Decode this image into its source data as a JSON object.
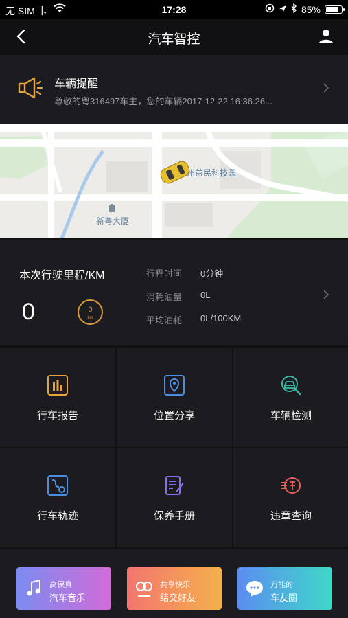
{
  "status_bar": {
    "carrier": "无 SIM 卡",
    "time": "17:28",
    "battery_percent": "85%",
    "battery_level": 0.85
  },
  "nav": {
    "title": "汽车智控"
  },
  "reminder": {
    "title": "车辆提醒",
    "message": "尊敬的粤316497车主，您的车辆2017-12-22 16:36:26..."
  },
  "map": {
    "poi_1": "州益民科技园",
    "poi_2": "新粤大厦"
  },
  "trip": {
    "title": "本次行驶里程/KM",
    "mileage": "0",
    "gauge_value": "0",
    "gauge_unit": "km",
    "stats": [
      {
        "label": "行程时间",
        "value": "0分钟"
      },
      {
        "label": "消耗油量",
        "value": "0L"
      },
      {
        "label": "平均油耗",
        "value": "0L/100KM"
      }
    ]
  },
  "features": [
    {
      "label": "行车报告",
      "icon": "report-chart-icon",
      "color": "#e8a23a"
    },
    {
      "label": "位置分享",
      "icon": "location-share-icon",
      "color": "#4a90e2"
    },
    {
      "label": "车辆检测",
      "icon": "car-inspection-icon",
      "color": "#39b9a5"
    },
    {
      "label": "行车轨迹",
      "icon": "route-track-icon",
      "color": "#4a90e2"
    },
    {
      "label": "保养手册",
      "icon": "maintenance-manual-icon",
      "color": "#8a6cf0"
    },
    {
      "label": "违章查询",
      "icon": "violation-query-icon",
      "color": "#e8605a"
    }
  ],
  "promos": [
    {
      "line1": "高保真",
      "line2": "汽车音乐",
      "icon": "music-icon"
    },
    {
      "line1": "共享快乐",
      "line2": "结交好友",
      "icon": "friends-icon"
    },
    {
      "line1": "万能的",
      "line2": "车友圈",
      "icon": "chat-bubble-icon"
    }
  ]
}
